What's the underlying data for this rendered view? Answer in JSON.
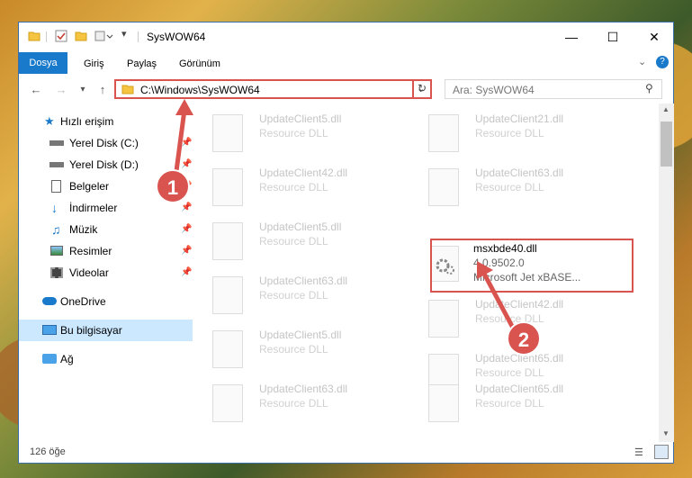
{
  "window": {
    "title": "SysWOW64"
  },
  "ribbon": {
    "tabs": [
      "Dosya",
      "Giriş",
      "Paylaş",
      "Görünüm"
    ]
  },
  "address": {
    "path": "C:\\Windows\\SysWOW64"
  },
  "search": {
    "placeholder": "Ara: SysWOW64"
  },
  "sidebar": {
    "items": [
      {
        "label": "Hızlı erişim",
        "icon": "star-icon",
        "pinned": false
      },
      {
        "label": "Yerel Disk (C:)",
        "icon": "drive-icon",
        "pinned": true
      },
      {
        "label": "Yerel Disk (D:)",
        "icon": "drive-icon",
        "pinned": true
      },
      {
        "label": "Belgeler",
        "icon": "document-icon",
        "pinned": true
      },
      {
        "label": "İndirmeler",
        "icon": "download-icon",
        "pinned": true
      },
      {
        "label": "Müzik",
        "icon": "music-icon",
        "pinned": true
      },
      {
        "label": "Resimler",
        "icon": "pictures-icon",
        "pinned": true
      },
      {
        "label": "Videolar",
        "icon": "videos-icon",
        "pinned": true
      },
      {
        "label": "OneDrive",
        "icon": "cloud-icon",
        "pinned": false
      },
      {
        "label": "Bu bilgisayar",
        "icon": "computer-icon",
        "pinned": false
      },
      {
        "label": "Ağ",
        "icon": "network-icon",
        "pinned": false
      }
    ]
  },
  "files": [
    {
      "name": "UpdateClient5.dll",
      "desc": "Resource DLL"
    },
    {
      "name": "UpdateClient21.dll",
      "desc": "Resource DLL"
    },
    {
      "name": "UpdateClient42.dll",
      "desc": "Resource DLL"
    },
    {
      "name": "UpdateClient63.dll",
      "desc": "Resource DLL"
    },
    {
      "name": "UpdateClient5.dll",
      "desc": "Resource DLL"
    },
    {
      "name": "msxbde40.dll",
      "version": "4.0.9502.0",
      "desc": "Microsoft Jet xBASE..."
    },
    {
      "name": "UpdateClient63.dll",
      "desc": "Resource DLL"
    },
    {
      "name": "UpdateClient42.dll",
      "desc": "Resource DLL"
    },
    {
      "name": "UpdateClient5.dll",
      "desc": "Resource DLL"
    },
    {
      "name": "UpdateClient65.dll",
      "desc": "Resource DLL"
    },
    {
      "name": "UpdateClient63.dll",
      "desc": "Resource DLL"
    },
    {
      "name": "UpdateClient65.dll",
      "desc": "Resource DLL"
    }
  ],
  "status": {
    "count": "126 öğe"
  },
  "annotations": {
    "badge1": "1",
    "badge2": "2"
  },
  "colors": {
    "accent": "#1979ca",
    "highlight": "#d9534f",
    "selected": "#cce8ff"
  }
}
